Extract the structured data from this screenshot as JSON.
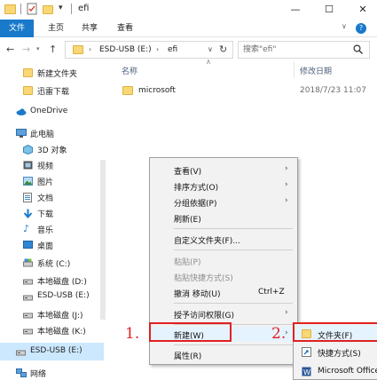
{
  "window": {
    "title": "efi",
    "minimize": "—",
    "maximize": "☐",
    "close": "✕"
  },
  "ribbon": {
    "tabs": [
      "文件",
      "主页",
      "共享",
      "查看"
    ],
    "expand": "∨",
    "help": "?"
  },
  "address": {
    "crumbs": [
      "ESD-USB (E:)",
      "efi"
    ],
    "separator": "›",
    "dropdown": "∨",
    "refresh": "↻"
  },
  "search": {
    "placeholder": "搜索\"efi\"",
    "icon": "search-icon"
  },
  "sidebar": {
    "items": [
      {
        "label": "新建文件夹",
        "icon": "folder-icon"
      },
      {
        "label": "迅雷下载",
        "icon": "folder-icon"
      },
      {
        "label": "OneDrive",
        "icon": "cloud-icon"
      },
      {
        "label": "此电脑",
        "icon": "computer-icon"
      },
      {
        "label": "3D 对象",
        "icon": "cube-icon"
      },
      {
        "label": "视频",
        "icon": "video-icon"
      },
      {
        "label": "图片",
        "icon": "picture-icon"
      },
      {
        "label": "文档",
        "icon": "document-icon"
      },
      {
        "label": "下载",
        "icon": "download-icon"
      },
      {
        "label": "音乐",
        "icon": "music-icon"
      },
      {
        "label": "桌面",
        "icon": "desktop-icon"
      },
      {
        "label": "系统 (C:)",
        "icon": "drive-icon"
      },
      {
        "label": "本地磁盘 (D:)",
        "icon": "drive-icon"
      },
      {
        "label": "ESD-USB (E:)",
        "icon": "usb-drive-icon"
      },
      {
        "label": "本地磁盘 (J:)",
        "icon": "drive-icon"
      },
      {
        "label": "本地磁盘 (K:)",
        "icon": "drive-icon"
      },
      {
        "label": "ESD-USB (E:)",
        "icon": "usb-drive-icon",
        "selected": true
      },
      {
        "label": "网络",
        "icon": "network-icon"
      }
    ]
  },
  "columns": {
    "name": "名称",
    "date": "修改日期"
  },
  "files": [
    {
      "name": "microsoft",
      "date": "2018/7/23 11:07"
    }
  ],
  "context_menu": {
    "items": [
      {
        "label": "查看(V)",
        "submenu": true
      },
      {
        "label": "排序方式(O)",
        "submenu": true
      },
      {
        "label": "分组依据(P)",
        "submenu": true
      },
      {
        "label": "刷新(E)"
      },
      {
        "label": "自定义文件夹(F)..."
      },
      {
        "label": "粘贴(P)",
        "disabled": true
      },
      {
        "label": "粘贴快捷方式(S)",
        "disabled": true
      },
      {
        "label": "撤消 移动(U)",
        "shortcut": "Ctrl+Z"
      },
      {
        "label": "授予访问权限(G)",
        "submenu": true
      },
      {
        "label": "新建(W)",
        "submenu": true
      },
      {
        "label": "属性(R)"
      }
    ]
  },
  "submenu": {
    "items": [
      {
        "label": "文件夹(F)",
        "icon": "folder-icon"
      },
      {
        "label": "快捷方式(S)",
        "icon": "shortcut-icon"
      },
      {
        "label": "Microsoft Office",
        "icon": "word-icon"
      }
    ]
  },
  "annotations": {
    "step1": "1.",
    "step2": "2.",
    "color": "#e22020"
  },
  "colors": {
    "accent": "#1979ca",
    "folder": "#f8d775",
    "selection": "#cce8ff"
  }
}
